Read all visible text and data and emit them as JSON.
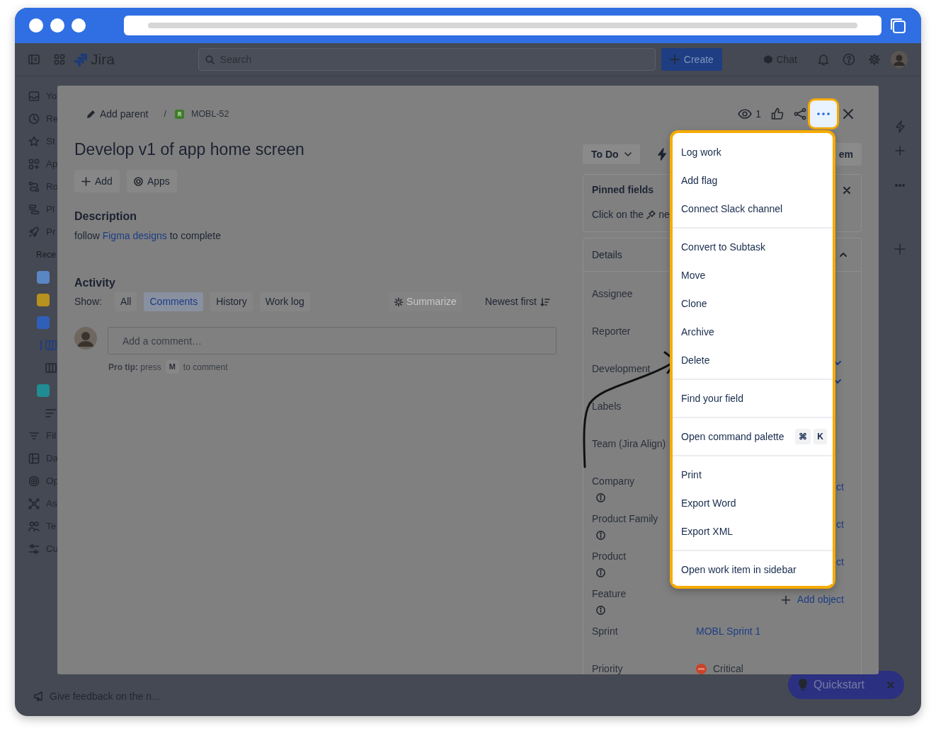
{
  "topbar": {
    "product": "Jira",
    "search": {
      "placeholder": "Search"
    },
    "create": "Create",
    "chat": "Chat"
  },
  "sidebar": {
    "items": [
      {
        "kind": "nav",
        "label": "Yo"
      },
      {
        "kind": "nav",
        "label": "Re"
      },
      {
        "kind": "nav",
        "label": "St"
      },
      {
        "kind": "nav",
        "label": "Ap"
      },
      {
        "kind": "nav",
        "label": "Ro"
      },
      {
        "kind": "nav",
        "label": "Pl"
      },
      {
        "kind": "nav",
        "label": "Pr"
      },
      {
        "kind": "heading",
        "label": "Rece"
      },
      {
        "kind": "project",
        "color": "#5a86c4"
      },
      {
        "kind": "project",
        "color": "#b8921e"
      },
      {
        "kind": "project",
        "color": "#2f5fb8"
      },
      {
        "kind": "board",
        "selected": true
      },
      {
        "kind": "board",
        "selected": false
      },
      {
        "kind": "project",
        "color": "#1f8d93"
      },
      {
        "kind": "list"
      },
      {
        "kind": "nav",
        "label": "Fil"
      },
      {
        "kind": "nav",
        "label": "Da"
      },
      {
        "kind": "nav",
        "label": "Op"
      },
      {
        "kind": "nav",
        "label": "As"
      },
      {
        "kind": "nav",
        "label": "Te"
      },
      {
        "kind": "nav",
        "label": "Cu"
      }
    ]
  },
  "footer": {
    "feedback": "Give feedback on the n..."
  },
  "quickstart": {
    "label": "Quickstart"
  },
  "modal": {
    "parent": "Add parent",
    "separator": "/",
    "key": "MOBL-52",
    "watchers": "1",
    "title": "Develop v1 of app home screen",
    "actions": [
      "Add",
      "Apps"
    ],
    "description": {
      "heading": "Description",
      "before": "follow",
      "link": "Figma designs",
      "after": "to complete"
    },
    "activity": {
      "heading": "Activity",
      "show_label": "Show:",
      "filters": [
        {
          "label": "All",
          "selected": false
        },
        {
          "label": "Comments",
          "selected": true
        },
        {
          "label": "History",
          "selected": false
        },
        {
          "label": "Work log",
          "selected": false
        }
      ],
      "summarize": {
        "label": "Summarize",
        "disabled": true
      },
      "sort": "Newest first",
      "comment_placeholder": "Add a comment…",
      "tip": {
        "text": "**Pro tip:** press",
        "key": "M",
        "after": "to comment"
      }
    },
    "status": "To Do",
    "improve_button": "em",
    "pinned": {
      "title": "Pinned fields",
      "hint_before": "Click on the",
      "hint_after": "ne"
    },
    "details": {
      "title": "Details",
      "expanded": true,
      "fields": [
        {
          "label": "Assignee",
          "info": false
        },
        {
          "label": "Reporter",
          "info": false
        },
        {
          "label": "Development",
          "info": false,
          "kind": "chevrons"
        },
        {
          "label": "Labels",
          "info": false
        },
        {
          "label": "Team (Jira Align)",
          "info": false
        },
        {
          "label": "Company",
          "info": true,
          "kind": "cut",
          "value": "ct"
        },
        {
          "label": "Product Family",
          "info": true,
          "kind": "cut",
          "value": "ct"
        },
        {
          "label": "Product",
          "info": true,
          "kind": "cut",
          "value": "ct"
        },
        {
          "label": "Feature",
          "info": true,
          "kind": "add",
          "value": "Add object"
        },
        {
          "label": "Sprint",
          "info": false,
          "kind": "link",
          "value": "MOBL Sprint 1"
        },
        {
          "label": "Priority",
          "info": false,
          "kind": "priority",
          "value": "Critical"
        }
      ]
    },
    "more_menu": {
      "open": true,
      "groups": [
        [
          {
            "label": "Log work"
          },
          {
            "label": "Add flag"
          },
          {
            "label": "Connect Slack channel"
          }
        ],
        [
          {
            "label": "Convert to Subtask"
          },
          {
            "label": "Move"
          },
          {
            "label": "Clone"
          },
          {
            "label": "Archive"
          },
          {
            "label": "Delete"
          }
        ],
        [
          {
            "label": "Find your field"
          }
        ],
        [
          {
            "label": "Open command palette",
            "shortcut": [
              "⌘",
              "K"
            ]
          }
        ],
        [
          {
            "label": "Print"
          },
          {
            "label": "Export Word"
          },
          {
            "label": "Export XML"
          }
        ],
        [
          {
            "label": "Open work item in sidebar"
          }
        ]
      ]
    }
  }
}
